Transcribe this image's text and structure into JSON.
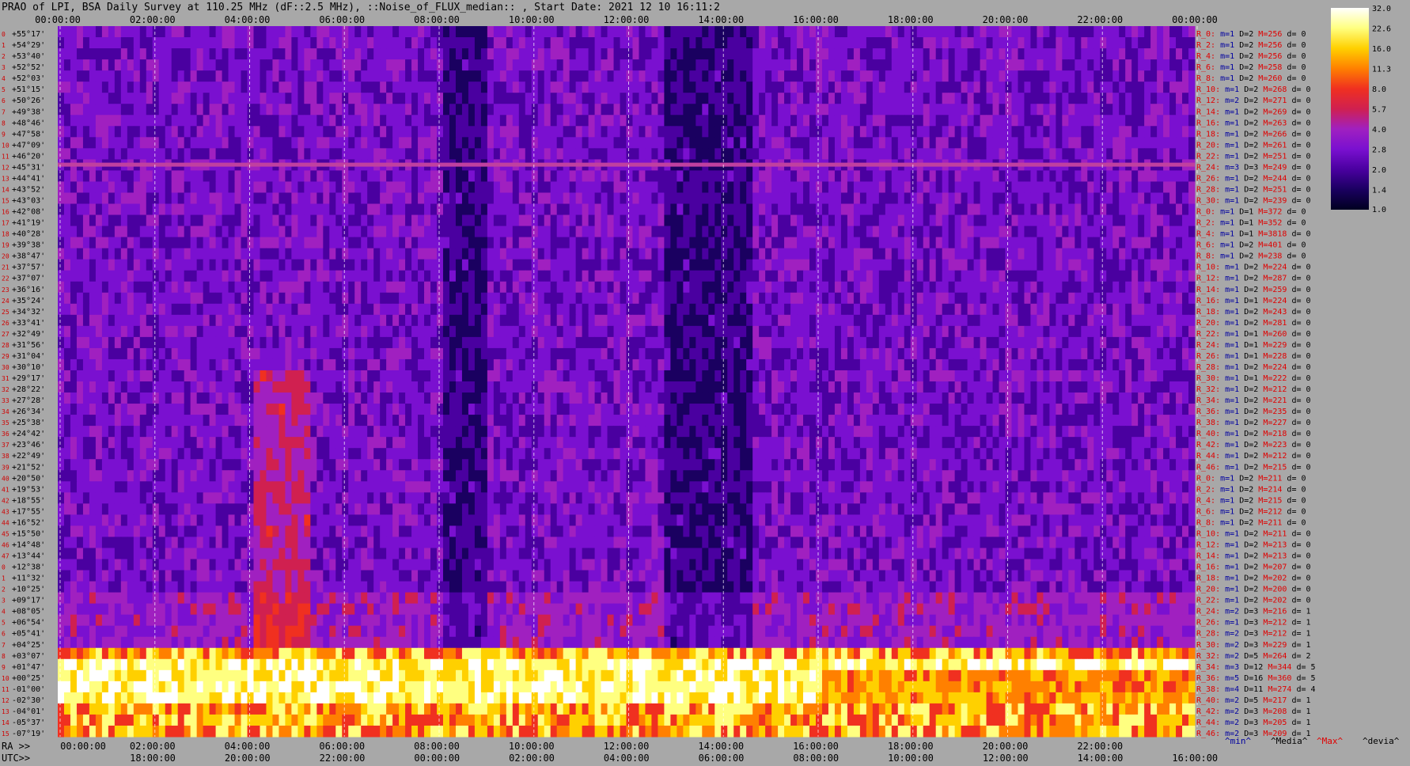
{
  "title": "PRAO of LPI, BSA Daily Survey at 110.25 MHz (dF::2.5 MHz), ::Noise_of_FLUX_median:: , Start Date: 2021 12 10 16:11:2",
  "chart_data": {
    "type": "heatmap",
    "time_labels_top": [
      "00:00:00",
      "02:00:00",
      "04:00:00",
      "06:00:00",
      "08:00:00",
      "10:00:00",
      "12:00:00",
      "14:00:00",
      "16:00:00",
      "18:00:00",
      "20:00:00",
      "22:00:00",
      "00:00:00"
    ],
    "ra_labels": [
      "00:00:00",
      "02:00:00",
      "04:00:00",
      "06:00:00",
      "08:00:00",
      "10:00:00",
      "12:00:00",
      "14:00:00",
      "16:00:00",
      "18:00:00",
      "20:00:00",
      "22:00:00"
    ],
    "ra_prefix": "RA >>",
    "utc_prefix": "UTC>>",
    "utc_labels": [
      "18:00:00",
      "20:00:00",
      "22:00:00",
      "00:00:00",
      "02:00:00",
      "04:00:00",
      "06:00:00",
      "08:00:00",
      "10:00:00",
      "12:00:00",
      "14:00:00",
      "16:00:00"
    ],
    "dec_labels": [
      "+55°17'",
      "+54°29'",
      "+53°40'",
      "+52°52'",
      "+52°03'",
      "+51°15'",
      "+50°26'",
      "+49°38'",
      "+48°46'",
      "+47°58'",
      "+47°09'",
      "+46°20'",
      "+45°31'",
      "+44°41'",
      "+43°52'",
      "+43°03'",
      "+42°08'",
      "+41°19'",
      "+40°28'",
      "+39°38'",
      "+38°47'",
      "+37°57'",
      "+37°07'",
      "+36°16'",
      "+35°24'",
      "+34°32'",
      "+33°41'",
      "+32°49'",
      "+31°56'",
      "+31°04'",
      "+30°10'",
      "+29°17'",
      "+28°22'",
      "+27°28'",
      "+26°34'",
      "+25°38'",
      "+24°42'",
      "+23°46'",
      "+22°49'",
      "+21°52'",
      "+20°50'",
      "+19°53'",
      "+18°55'",
      "+17°55'",
      "+16°52'",
      "+15°50'",
      "+14°48'",
      "+13°44'",
      "+12°38'",
      "+11°32'",
      "+10°25'",
      "+09°17'",
      "+08°05'",
      "+06°54'",
      "+05°41'",
      "+04°25'",
      "+03°07'",
      "+01°47'",
      "+00°25'",
      "-01°00'",
      "-02°30'",
      "-04°01'",
      "-05°37'",
      "-07°19'"
    ],
    "right_rows": [
      [
        "R_0:",
        "1",
        "2",
        "256",
        "0"
      ],
      [
        "R_2:",
        "1",
        "2",
        "256",
        "0"
      ],
      [
        "R_4:",
        "1",
        "2",
        "256",
        "0"
      ],
      [
        "R_6:",
        "1",
        "2",
        "258",
        "0"
      ],
      [
        "R_8:",
        "1",
        "2",
        "260",
        "0"
      ],
      [
        "R_10:",
        "1",
        "2",
        "268",
        "0"
      ],
      [
        "R_12:",
        "2",
        "2",
        "271",
        "0"
      ],
      [
        "R_14:",
        "1",
        "2",
        "269",
        "0"
      ],
      [
        "R_16:",
        "1",
        "2",
        "263",
        "0"
      ],
      [
        "R_18:",
        "1",
        "2",
        "266",
        "0"
      ],
      [
        "R_20:",
        "1",
        "2",
        "261",
        "0"
      ],
      [
        "R_22:",
        "1",
        "2",
        "251",
        "0"
      ],
      [
        "R_24:",
        "3",
        "3",
        "249",
        "0"
      ],
      [
        "R_26:",
        "1",
        "2",
        "244",
        "0"
      ],
      [
        "R_28:",
        "1",
        "2",
        "251",
        "0"
      ],
      [
        "R_30:",
        "1",
        "2",
        "239",
        "0"
      ],
      [
        "R_0:",
        "1",
        "1",
        "372",
        "0"
      ],
      [
        "R_2:",
        "1",
        "1",
        "352",
        "0"
      ],
      [
        "R_4:",
        "1",
        "1",
        "3818",
        "0"
      ],
      [
        "R_6:",
        "1",
        "2",
        "401",
        "0"
      ],
      [
        "R_8:",
        "1",
        "2",
        "238",
        "0"
      ],
      [
        "R_10:",
        "1",
        "2",
        "224",
        "0"
      ],
      [
        "R_12:",
        "1",
        "2",
        "287",
        "0"
      ],
      [
        "R_14:",
        "1",
        "2",
        "259",
        "0"
      ],
      [
        "R_16:",
        "1",
        "1",
        "224",
        "0"
      ],
      [
        "R_18:",
        "1",
        "2",
        "243",
        "0"
      ],
      [
        "R_20:",
        "1",
        "2",
        "281",
        "0"
      ],
      [
        "R_22:",
        "1",
        "1",
        "260",
        "0"
      ],
      [
        "R_24:",
        "1",
        "1",
        "229",
        "0"
      ],
      [
        "R_26:",
        "1",
        "1",
        "228",
        "0"
      ],
      [
        "R_28:",
        "1",
        "2",
        "224",
        "0"
      ],
      [
        "R_30:",
        "1",
        "1",
        "222",
        "0"
      ],
      [
        "R_32:",
        "1",
        "2",
        "212",
        "0"
      ],
      [
        "R_34:",
        "1",
        "2",
        "221",
        "0"
      ],
      [
        "R_36:",
        "1",
        "2",
        "235",
        "0"
      ],
      [
        "R_38:",
        "1",
        "2",
        "227",
        "0"
      ],
      [
        "R_40:",
        "1",
        "2",
        "218",
        "0"
      ],
      [
        "R_42:",
        "1",
        "2",
        "223",
        "0"
      ],
      [
        "R_44:",
        "1",
        "2",
        "212",
        "0"
      ],
      [
        "R_46:",
        "1",
        "2",
        "215",
        "0"
      ],
      [
        "R_0:",
        "1",
        "2",
        "211",
        "0"
      ],
      [
        "R_2:",
        "1",
        "2",
        "214",
        "0"
      ],
      [
        "R_4:",
        "1",
        "2",
        "215",
        "0"
      ],
      [
        "R_6:",
        "1",
        "2",
        "212",
        "0"
      ],
      [
        "R_8:",
        "1",
        "2",
        "211",
        "0"
      ],
      [
        "R_10:",
        "1",
        "2",
        "211",
        "0"
      ],
      [
        "R_12:",
        "1",
        "2",
        "213",
        "0"
      ],
      [
        "R_14:",
        "1",
        "2",
        "213",
        "0"
      ],
      [
        "R_16:",
        "1",
        "2",
        "207",
        "0"
      ],
      [
        "R_18:",
        "1",
        "2",
        "202",
        "0"
      ],
      [
        "R_20:",
        "1",
        "2",
        "200",
        "0"
      ],
      [
        "R_22:",
        "1",
        "2",
        "202",
        "0"
      ],
      [
        "R_24:",
        "2",
        "3",
        "216",
        "1"
      ],
      [
        "R_26:",
        "1",
        "3",
        "212",
        "1"
      ],
      [
        "R_28:",
        "2",
        "3",
        "212",
        "1"
      ],
      [
        "R_30:",
        "2",
        "3",
        "229",
        "1"
      ],
      [
        "R_32:",
        "2",
        "5",
        "264",
        "2"
      ],
      [
        "R_34:",
        "3",
        "12",
        "344",
        "5"
      ],
      [
        "R_36:",
        "5",
        "16",
        "360",
        "5"
      ],
      [
        "R_38:",
        "4",
        "11",
        "274",
        "4"
      ],
      [
        "R_40:",
        "2",
        "5",
        "217",
        "1"
      ],
      [
        "R_42:",
        "2",
        "3",
        "208",
        "1"
      ],
      [
        "R_44:",
        "2",
        "3",
        "205",
        "1"
      ],
      [
        "R_46:",
        "2",
        "3",
        "209",
        "1"
      ]
    ],
    "right_footer": [
      "^min^",
      "^Media^",
      "^Max^",
      "^devia^"
    ],
    "colorbar_ticks": [
      "32.0",
      "22.6",
      "16.0",
      "11.3",
      "8.0",
      "5.7",
      "4.0",
      "2.8",
      "2.0",
      "1.4",
      "1.0"
    ],
    "colorscale": [
      "#000020",
      "#1a0060",
      "#4a00a0",
      "#7a10d0",
      "#a020c0",
      "#d02050",
      "#f03020",
      "#ff8000",
      "#ffd000",
      "#ffff80",
      "#ffffff"
    ],
    "bright_band_rows": [
      56,
      63
    ],
    "horizontal_line_dec": "+45°31'",
    "highlight_line_color": "#c040a0",
    "label_color_red": "#e00000",
    "label_color_blue": "#0000a0"
  }
}
